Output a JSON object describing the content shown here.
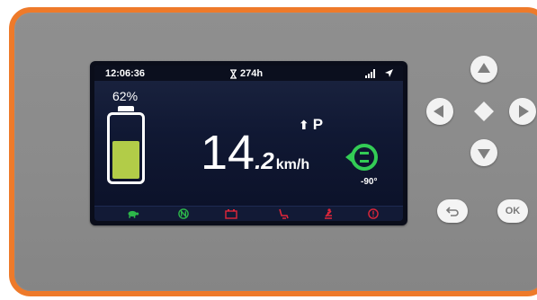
{
  "status": {
    "time": "12:06:36",
    "hours": "274h",
    "signal_icon": "signal-bars-icon",
    "gps_icon": "gps-arrow-icon"
  },
  "battery": {
    "percent_label": "62%",
    "fill_fraction": 0.62,
    "fill_color": "#b2cc48"
  },
  "speed": {
    "integer": "14",
    "decimal": ".2",
    "unit": "km/h"
  },
  "gear": {
    "label": "P",
    "arrow": "⬆"
  },
  "steering": {
    "angle": "-90°",
    "icon": "steering-mode-icon",
    "color": "#33cc55"
  },
  "indicators": [
    {
      "name": "turtle-icon",
      "color": "#2db84a"
    },
    {
      "name": "neutral-n-icon",
      "color": "#2db84a"
    },
    {
      "name": "battery-warning-icon",
      "color": "#e0263a"
    },
    {
      "name": "seat-warning-icon",
      "color": "#e0263a"
    },
    {
      "name": "seatbelt-warning-icon",
      "color": "#e0263a"
    },
    {
      "name": "brake-warning-icon",
      "color": "#e0263a"
    }
  ],
  "keypad": {
    "ok_label": "OK",
    "back_icon": "back-arrow-icon"
  },
  "colors": {
    "bezel": "#ee7a2a",
    "panel": "#8b8b8b",
    "screen": "#101833"
  }
}
